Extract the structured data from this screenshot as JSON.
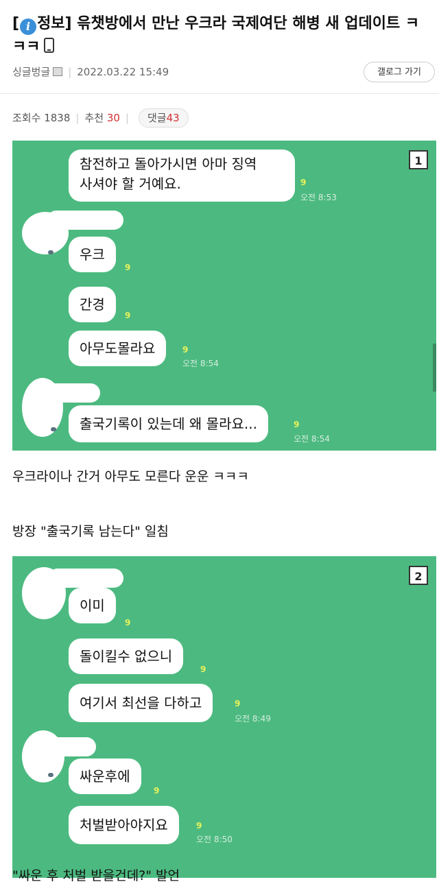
{
  "post": {
    "title_prefix_open": "[",
    "title_tag": "정보",
    "title_text": "] 윾챗방에서 만난 우크라 국제여단 해병 새 업데이트 ㅋㅋㅋ",
    "author": "싱글벙글",
    "date": "2022.03.22 15:49",
    "gallery_button": "갤로그 가기",
    "views_label": "조회수",
    "views": "1838",
    "recommend_label": "추천",
    "recommend": "30",
    "comments_label": "댓글",
    "comments": "43"
  },
  "panel1": {
    "badge": "1",
    "bubbles": [
      {
        "line1": "참전하고 돌아가시면 아마 징역",
        "line2": "사셔야 할 거예요.",
        "read": "9",
        "time": "오전 8:53"
      },
      {
        "text": "우크",
        "read": "9"
      },
      {
        "text": "간경",
        "read": "9"
      },
      {
        "text": "아무도몰라요",
        "read": "9",
        "time": "오전 8:54"
      },
      {
        "text": "출국기록이 있는데 왜 몰라요...",
        "read": "9",
        "time": "오전 8:54"
      }
    ]
  },
  "caption1": "우크라이나 간거 아무도 모른다 운운 ㅋㅋㅋ",
  "caption2": "방장 \"출국기록 남는다\" 일침",
  "panel2": {
    "badge": "2",
    "bubbles": [
      {
        "text": "이미",
        "read": "9"
      },
      {
        "text": "돌이킬수 없으니",
        "read": "9"
      },
      {
        "text": "여기서 최선을 다하고",
        "read": "9",
        "time": "오전 8:49"
      },
      {
        "text": "싸운후에",
        "read": "9"
      },
      {
        "text": "처벌받아야지요",
        "read": "9",
        "time": "오전 8:50"
      }
    ]
  },
  "caption3": "\"싸운 후 처벌 받을건데?\" 발언",
  "colors": {
    "chat_bg": "#4cba80",
    "accent_red": "#d32f2f",
    "read_yellow": "#e9f25a",
    "info_blue": "#3a8fd8"
  },
  "icons": {
    "tag": "info-icon",
    "title_suffix": "phone-icon",
    "author": "image-icon"
  }
}
